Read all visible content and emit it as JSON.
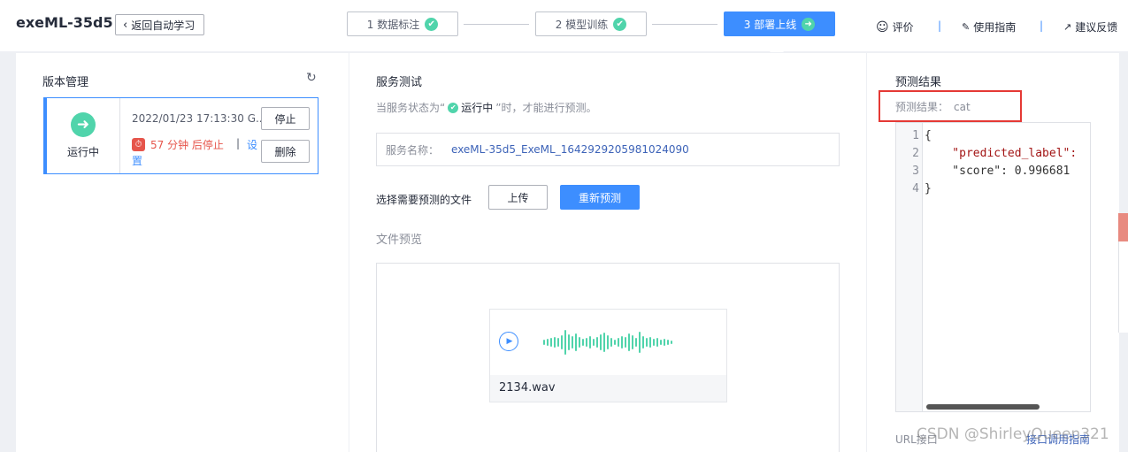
{
  "app": {
    "title": "exeML-35d5",
    "back_label": "返回自动学习"
  },
  "steps": [
    {
      "label": "1 数据标注",
      "state": "done"
    },
    {
      "label": "2 模型训练",
      "state": "done"
    },
    {
      "label": "3 部署上线",
      "state": "active"
    }
  ],
  "top_links": {
    "rate": "评价",
    "guide": "使用指南",
    "feedback": "建议反馈"
  },
  "left": {
    "title": "版本管理",
    "version": {
      "status": "运行中",
      "datetime": "2022/01/23 17:13:30 G...",
      "stop_text": "57 分钟 后停止",
      "settings_a": "设",
      "settings_b": "置",
      "stop_button": "停止",
      "delete_button": "删除"
    }
  },
  "middle": {
    "title": "服务测试",
    "hint_prefix": "当服务状态为“",
    "hint_status": "运行中",
    "hint_suffix": "”时，才能进行预测。",
    "service_key": "服务名称：",
    "service_value": "exeML-35d5_ExeML_1642929205981024090",
    "file_label": "选择需要预测的文件",
    "upload_button": "上传",
    "predict_button": "重新预测",
    "preview_label": "文件预览",
    "audio_filename": "2134.wav"
  },
  "right": {
    "title": "预测结果",
    "result_key": "预测结果：",
    "result_value": "cat",
    "code_lines": [
      "{",
      "    \"predicted_label\":",
      "    \"score\": 0.996681",
      "}"
    ],
    "line_numbers": [
      "1",
      "2",
      "3",
      "4"
    ],
    "url_label": "URL接口",
    "api_link": "接口调用指南"
  },
  "watermark": "CSDN @ShirleyQueen321",
  "colors": {
    "accent": "#3d8eff",
    "success": "#50d4ab",
    "danger": "#e6554b",
    "highlight": "#e53935"
  }
}
